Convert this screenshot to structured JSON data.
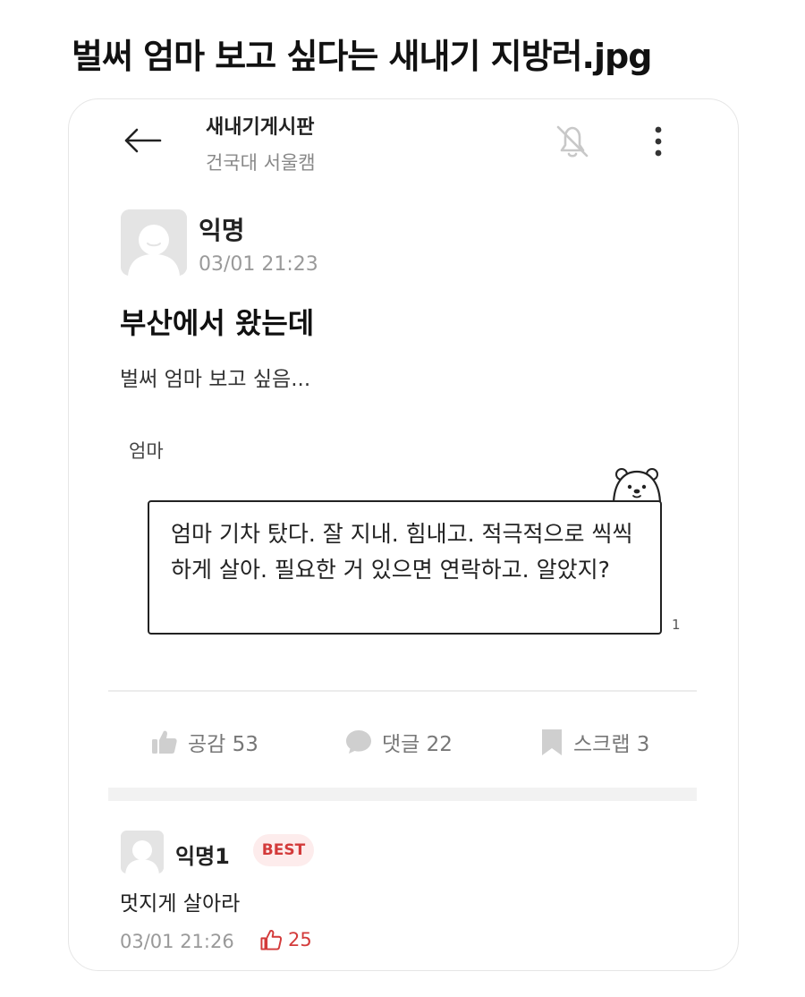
{
  "caption": "벌써 엄마 보고 싶다는 새내기 지방러.jpg",
  "header": {
    "title": "새내기게시판",
    "subtitle": "건국대 서울캠",
    "icons": {
      "back": "arrow-left-icon",
      "bell": "bell-off-icon",
      "more": "more-vertical-icon"
    }
  },
  "post": {
    "author": "익명",
    "time": "03/01 21:23",
    "title": "부산에서 왔는데",
    "body": "벌써 엄마 보고 싶음...",
    "image": {
      "label": "엄마",
      "message": "엄마 기차 탔다. 잘 지내. 힘내고. 적극적으로 씩씩하게 살아. 필요한 거 있으면 연락하고. 알았지?",
      "unread_count": "1",
      "sticker_icon": "bear-icon"
    }
  },
  "actions": {
    "like_label": "공감 53",
    "comment_label": "댓글 22",
    "scrap_label": "스크랩 3",
    "icons": {
      "like": "thumbs-up-icon",
      "comment": "chat-bubble-icon",
      "scrap": "bookmark-icon"
    }
  },
  "comment": {
    "author": "익명1",
    "badge": "BEST",
    "text": "멋지게 살아라",
    "time": "03/01 21:26",
    "likes": "25"
  },
  "colors": {
    "accent": "#d33a3a",
    "muted": "#999999",
    "avatar_bg": "#e4e4e4"
  }
}
